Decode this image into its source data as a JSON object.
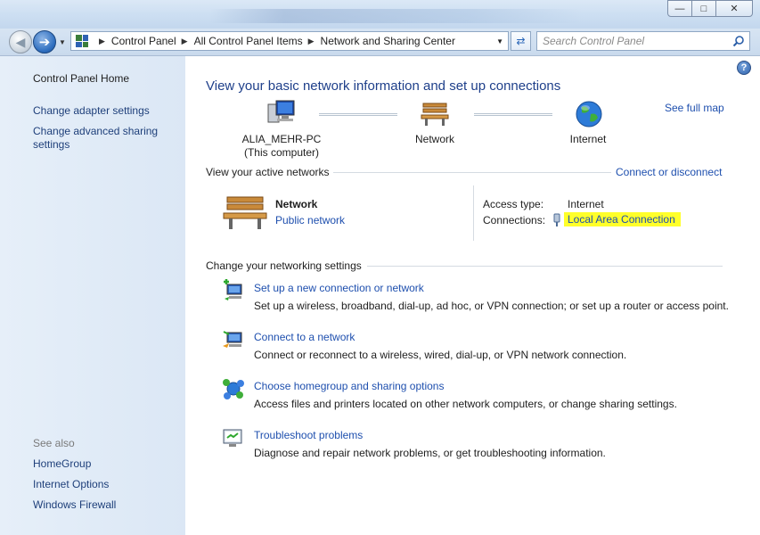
{
  "window": {
    "minimize_label": "—",
    "maximize_label": "□",
    "close_label": "✕"
  },
  "address": {
    "crumbs": [
      "Control Panel",
      "All Control Panel Items",
      "Network and Sharing Center"
    ],
    "search_placeholder": "Search Control Panel"
  },
  "sidebar": {
    "home": "Control Panel Home",
    "links": [
      "Change adapter settings",
      "Change advanced sharing settings"
    ],
    "see_also_title": "See also",
    "see_also": [
      "HomeGroup",
      "Internet Options",
      "Windows Firewall"
    ]
  },
  "main": {
    "title": "View your basic network information and set up connections",
    "see_full_map": "See full map",
    "map": {
      "computer_name": "ALIA_MEHR-PC",
      "computer_sub": "(This computer)",
      "network": "Network",
      "internet": "Internet"
    },
    "active_networks_title": "View your active networks",
    "connect_or_disconnect": "Connect or disconnect",
    "active_network": {
      "name": "Network",
      "type": "Public network",
      "access_type_label": "Access type:",
      "access_type_value": "Internet",
      "connections_label": "Connections:",
      "connection_value": "Local Area Connection"
    },
    "settings_title": "Change your networking settings",
    "tasks": [
      {
        "title": "Set up a new connection or network",
        "desc": "Set up a wireless, broadband, dial-up, ad hoc, or VPN connection; or set up a router or access point."
      },
      {
        "title": "Connect to a network",
        "desc": "Connect or reconnect to a wireless, wired, dial-up, or VPN network connection."
      },
      {
        "title": "Choose homegroup and sharing options",
        "desc": "Access files and printers located on other network computers, or change sharing settings."
      },
      {
        "title": "Troubleshoot problems",
        "desc": "Diagnose and repair network problems, or get troubleshooting information."
      }
    ]
  },
  "colors": {
    "link": "#1e4fae",
    "title": "#1e3f8a",
    "highlight": "#ffff2a",
    "sidebar": "#e0eaf6"
  }
}
